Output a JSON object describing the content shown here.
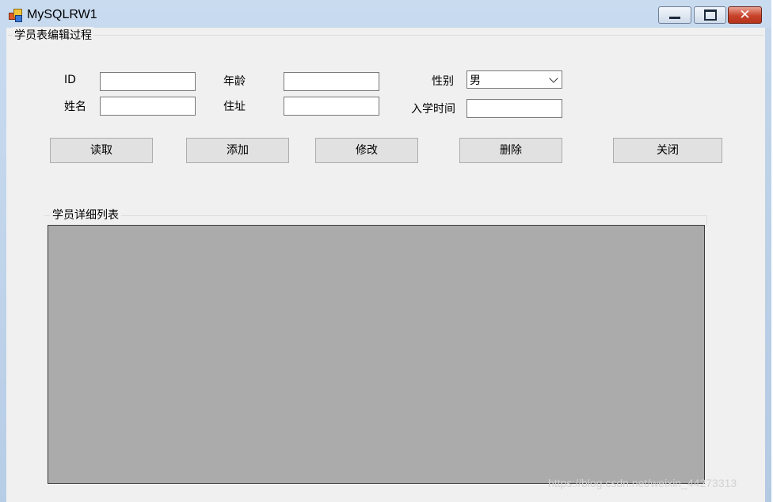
{
  "window": {
    "title": "MySQLRW1",
    "controls": {
      "minimize": "minimize",
      "maximize": "maximize",
      "close": "close"
    }
  },
  "edit_group": {
    "label": "学员表编辑过程",
    "fields": {
      "id": {
        "label": "ID",
        "value": ""
      },
      "age": {
        "label": "年龄",
        "value": ""
      },
      "gender": {
        "label": "性别",
        "selected": "男"
      },
      "name": {
        "label": "姓名",
        "value": ""
      },
      "address": {
        "label": "住址",
        "value": ""
      },
      "enroll_time": {
        "label": "入学时间",
        "value": ""
      }
    }
  },
  "buttons": {
    "read": "读取",
    "add": "添加",
    "modify": "修改",
    "delete": "删除",
    "close": "关闭"
  },
  "list_group": {
    "label": "学员详细列表"
  },
  "watermark": "https://blog.csdn.net/weixin_44273313",
  "colors": {
    "grid_background": "#ababab",
    "form_background": "#f0f0f0",
    "close_button": "#c8432a"
  }
}
